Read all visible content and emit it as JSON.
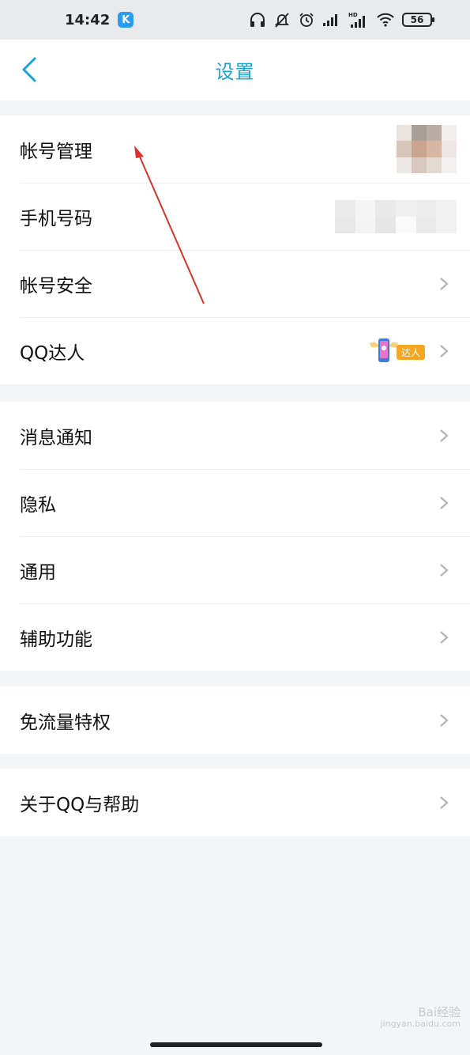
{
  "status_bar": {
    "time": "14:42",
    "app_icon": "kuwo-k-icon",
    "app_icon_letter": "K",
    "battery": "56",
    "hd_label": "HD",
    "icons": [
      "headphones-icon",
      "muted-bell-icon",
      "alarm-icon",
      "signal-icon",
      "signal-hd-icon",
      "wifi-icon",
      "battery-icon"
    ]
  },
  "nav": {
    "title": "设置",
    "back_icon": "chevron-left-icon"
  },
  "groups": {
    "account": {
      "account_manage": "帐号管理",
      "phone_number": "手机号码",
      "account_security": "帐号安全",
      "qq_daren": "QQ达人",
      "daren_badge": "达人"
    },
    "general": {
      "notifications": "消息通知",
      "privacy": "隐私",
      "general": "通用",
      "accessibility": "辅助功能"
    },
    "traffic": {
      "free_traffic": "免流量特权"
    },
    "about": {
      "about_help": "关于QQ与帮助"
    }
  },
  "watermark": {
    "line1": "Bai经验",
    "line2": "jingyan.baidu.com"
  },
  "colors": {
    "accent": "#1aa3d9",
    "background": "#f4f5f7",
    "annotation_arrow": "#d7342c"
  }
}
